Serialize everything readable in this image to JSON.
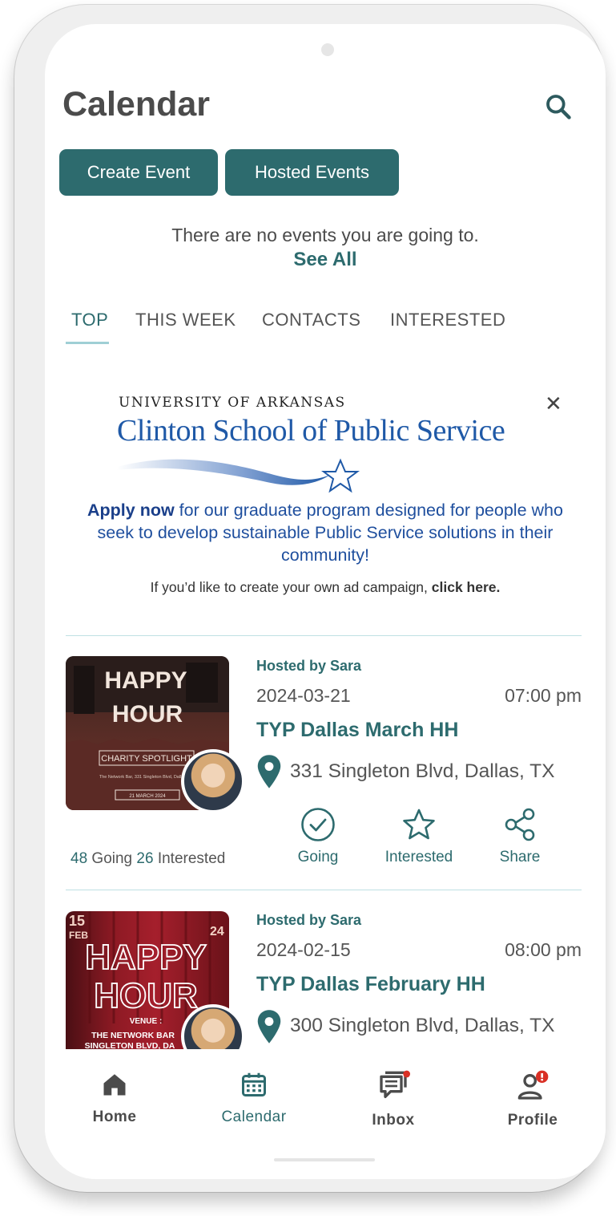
{
  "header": {
    "title": "Calendar"
  },
  "buttons": {
    "create_event": "Create Event",
    "hosted_events": "Hosted Events"
  },
  "going_status": {
    "message": "There are no events you are going to.",
    "see_all": "See All"
  },
  "tabs": [
    {
      "label": "TOP",
      "active": true
    },
    {
      "label": "THIS WEEK",
      "active": false
    },
    {
      "label": "CONTACTS",
      "active": false
    },
    {
      "label": "INTERESTED",
      "active": false
    }
  ],
  "ad": {
    "logo_top": "UNIVERSITY OF ARKANSAS",
    "logo_main": "Clinton School of Public Service",
    "apply_now": "Apply now",
    "body": " for our graduate program designed for people who seek to develop sustainable Public Service solutions in their community!",
    "cta_text": "If you’d like to create your own ad campaign, ",
    "cta_link": "click here."
  },
  "events": [
    {
      "hosted_by": "Hosted by Sara",
      "date": "2024-03-21",
      "time": "07:00 pm",
      "title": "TYP Dallas March HH",
      "address": "331 Singleton Blvd, Dallas, TX",
      "going_count": "48",
      "going_label": " Going ",
      "interested_count": "26",
      "interested_label": " Interested",
      "thumb_lines": [
        "HAPPY",
        "HOUR",
        "CHARITY SPOTLIGHT",
        "The Network Bar, 331 Singleton Blvd, Dallas, TX",
        "21 MARCH 2024"
      ]
    },
    {
      "hosted_by": "Hosted by Sara",
      "date": "2024-02-15",
      "time": "08:00 pm",
      "title": "TYP Dallas February HH",
      "address": "300 Singleton Blvd, Dallas, TX",
      "thumb_lines": [
        "15",
        "FEB",
        "24",
        "HAPPY",
        "HOUR",
        "VENUE :",
        "THE NETWORK BAR",
        "SINGLETON BLVD, DA"
      ]
    }
  ],
  "actions": {
    "going": "Going",
    "interested": "Interested",
    "share": "Share"
  },
  "nav": {
    "home": "Home",
    "calendar": "Calendar",
    "inbox": "Inbox",
    "profile": "Profile"
  },
  "colors": {
    "primary": "#2d6b6e",
    "ad_blue": "#1f59a7",
    "badge_red": "#d93025"
  }
}
